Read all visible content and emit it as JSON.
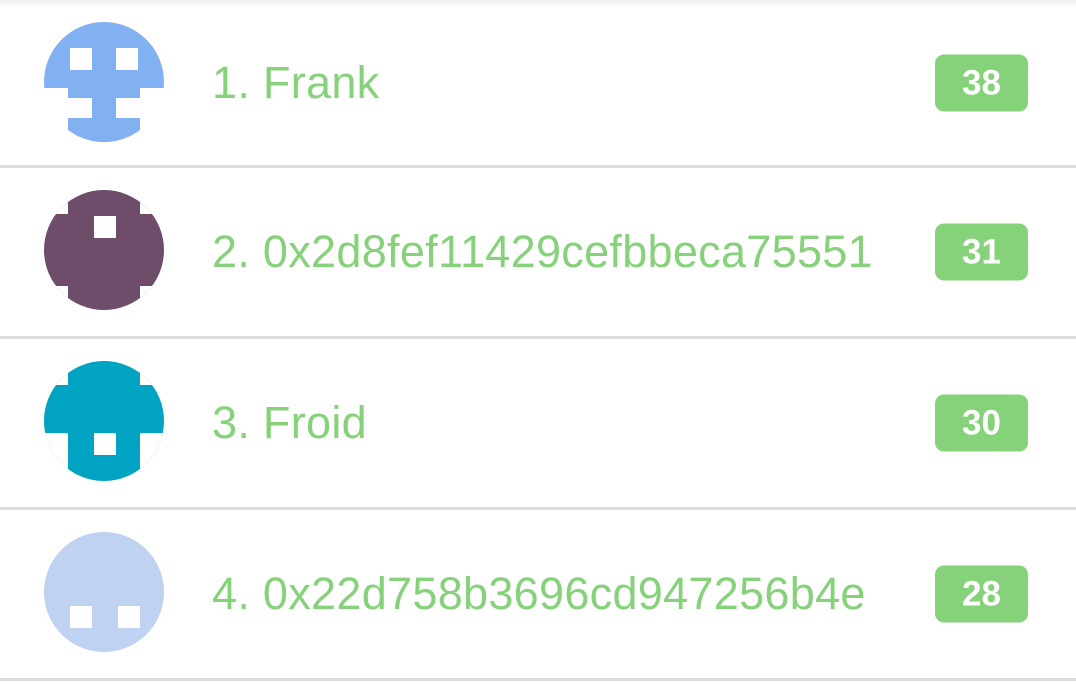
{
  "leaderboard": {
    "entries": [
      {
        "name": "1. Frank",
        "score": "38",
        "avatar_color": "#82b1f2",
        "avatar_icon": "identicon-avatar"
      },
      {
        "name": "2. 0x2d8fef11429cefbbeca75551",
        "score": "31",
        "avatar_color": "#6e4d6b",
        "avatar_icon": "identicon-avatar"
      },
      {
        "name": "3. Froid",
        "score": "30",
        "avatar_color": "#00a3c2",
        "avatar_icon": "identicon-avatar"
      },
      {
        "name": "4. 0x22d758b3696cd947256b4e",
        "score": "28",
        "avatar_color": "#c0d2f2",
        "avatar_icon": "identicon-avatar"
      }
    ],
    "accent_color": "#86d27a",
    "divider_color": "#dcdcdc"
  }
}
